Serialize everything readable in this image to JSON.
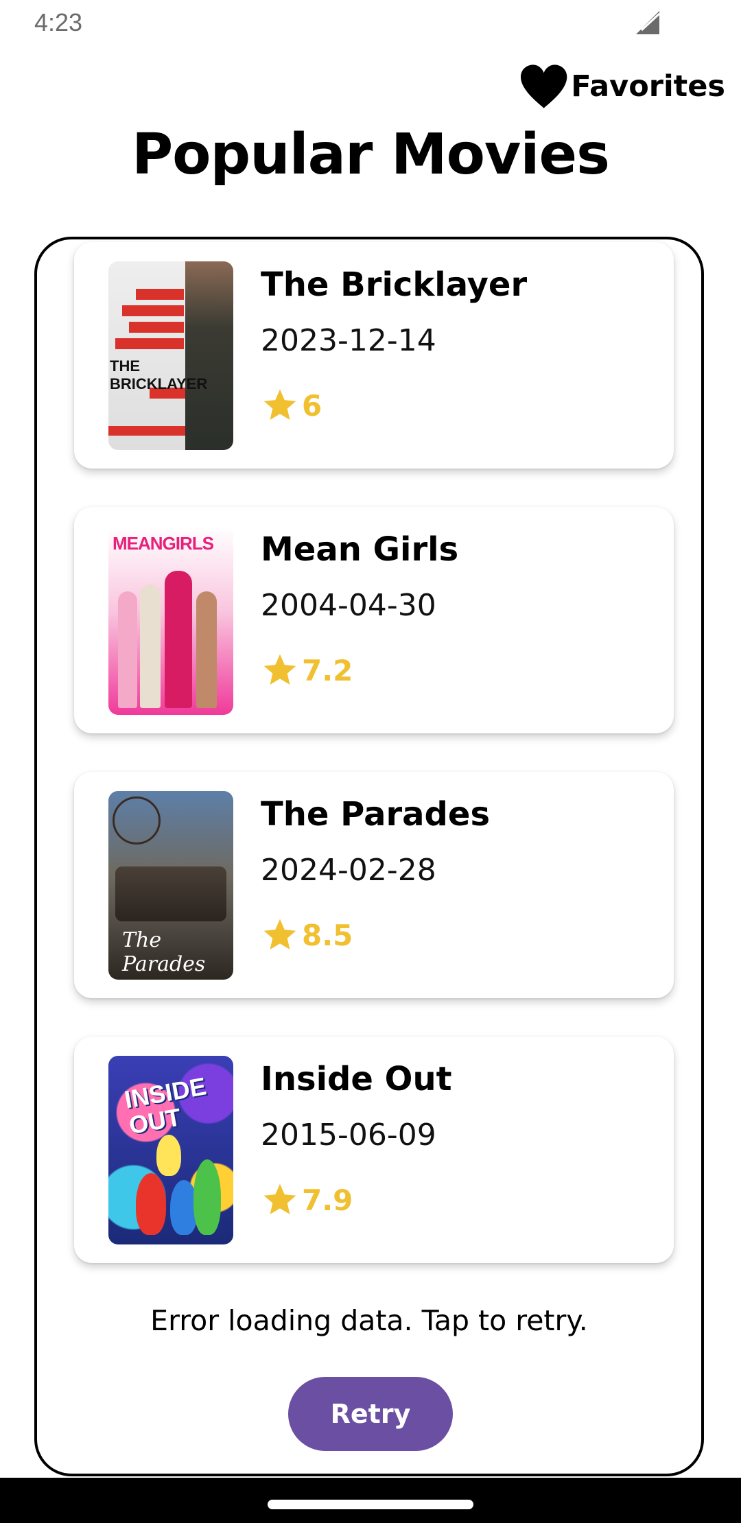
{
  "status_bar": {
    "time": "4:23",
    "signal_icon": "signal-icon"
  },
  "header": {
    "favorites_label": "Favorites",
    "favorites_icon": "heart-icon",
    "title": "Popular Movies"
  },
  "movies": [
    {
      "title": "The Bricklayer",
      "release_date": "2023-12-14",
      "rating": "6",
      "poster_text": "THE BRICKLAYER"
    },
    {
      "title": "Mean Girls",
      "release_date": "2004-04-30",
      "rating": "7.2",
      "poster_text": "MEANGIRLS"
    },
    {
      "title": "The Parades",
      "release_date": "2024-02-28",
      "rating": "8.5",
      "poster_text": "The Parades"
    },
    {
      "title": "Inside Out",
      "release_date": "2015-06-09",
      "rating": "7.9",
      "poster_text": "INSIDE OUT"
    }
  ],
  "error": {
    "message": "Error loading data. Tap to retry.",
    "retry_label": "Retry"
  },
  "colors": {
    "accent": "#6a4fa3",
    "rating": "#f0c030",
    "background": "#ffffff",
    "nav_bar": "#000000"
  }
}
